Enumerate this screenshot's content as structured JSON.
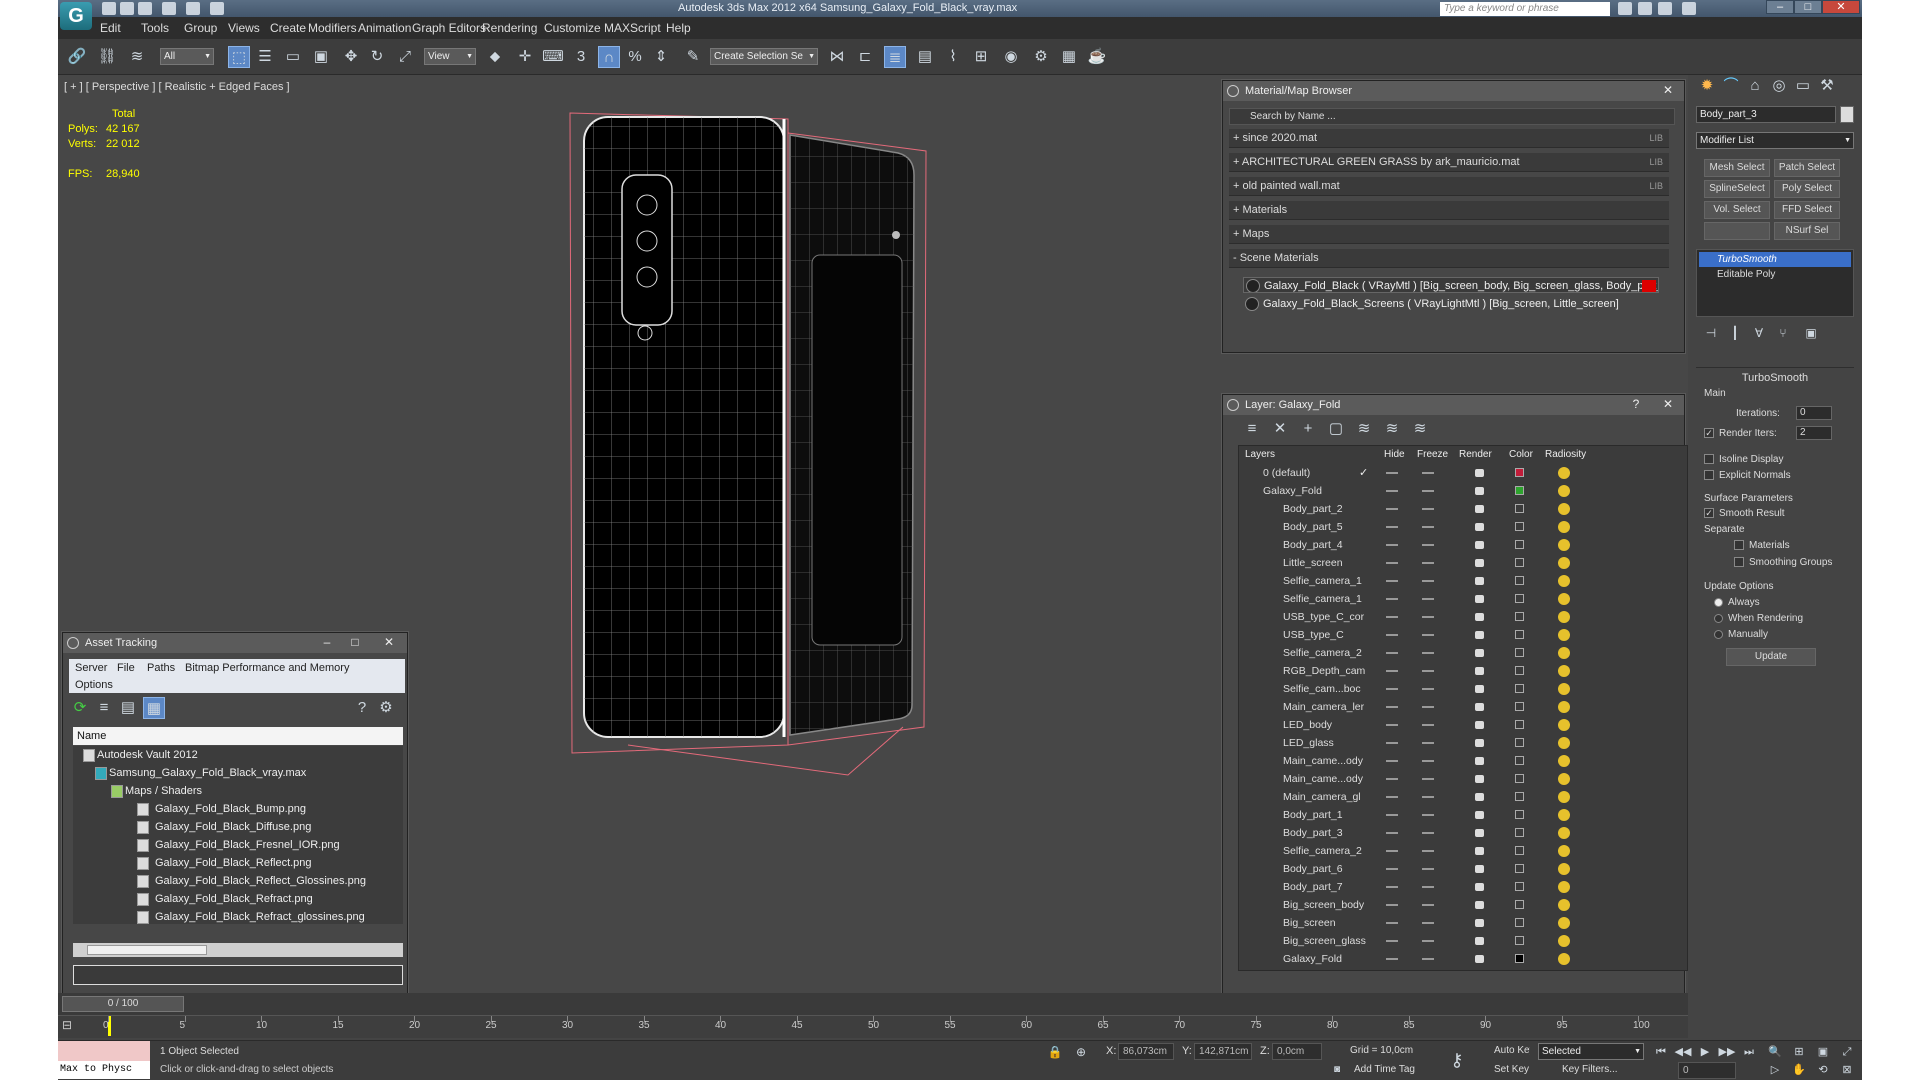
{
  "window": {
    "title": "Autodesk 3ds Max  2012 x64      Samsung_Galaxy_Fold_Black_vray.max",
    "search_placeholder": "Type a keyword or phrase",
    "app_icon": "3ds-max-logo"
  },
  "menu": [
    "Edit",
    "Tools",
    "Group",
    "Views",
    "Create",
    "Modifiers",
    "Animation",
    "Graph Editors",
    "Rendering",
    "Customize",
    "MAXScript",
    "Help"
  ],
  "toolbar": {
    "filter": "All",
    "ref_coord": "View",
    "selection_set": "Create Selection Se"
  },
  "viewport": {
    "label": "[ + ] [ Perspective ] [ Realistic + Edged Faces ]",
    "stats": {
      "total": "Total",
      "polys_label": "Polys:",
      "polys": "42 167",
      "verts_label": "Verts:",
      "verts": "22 012",
      "fps_label": "FPS:",
      "fps": "28,940"
    }
  },
  "material_browser": {
    "title": "Material/Map Browser",
    "search": "Search by Name ...",
    "groups": [
      {
        "label": "+ since 2020.mat",
        "tag": "LIB"
      },
      {
        "label": "+ ARCHITECTURAL GREEN GRASS by ark_mauricio.mat",
        "tag": "LIB"
      },
      {
        "label": "+ old painted wall.mat",
        "tag": "LIB"
      },
      {
        "label": "+ Materials",
        "tag": ""
      },
      {
        "label": "+ Maps",
        "tag": ""
      },
      {
        "label": "- Scene Materials",
        "tag": ""
      }
    ],
    "scene_materials": [
      "Galaxy_Fold_Black ( VRayMtl ) [Big_screen_body, Big_screen_glass, Body_part_",
      "Galaxy_Fold_Black_Screens ( VRayLightMtl ) [Big_screen, Little_screen]"
    ]
  },
  "layer_manager": {
    "title": "Layer: Galaxy_Fold",
    "columns": [
      "Layers",
      "Hide",
      "Freeze",
      "Render",
      "Color",
      "Radiosity"
    ],
    "layers": [
      "0 (default)",
      "Galaxy_Fold"
    ],
    "objects": [
      "Body_part_2",
      "Body_part_5",
      "Body_part_4",
      "Little_screen",
      "Selfie_camera_1",
      "Selfie_camera_1",
      "USB_type_C_cor",
      "USB_type_C",
      "Selfie_camera_2",
      "RGB_Depth_cam",
      "Selfie_cam...boc",
      "Main_camera_ler",
      "LED_body",
      "LED_glass",
      "Main_came...ody",
      "Main_came...ody",
      "Main_camera_gl",
      "Body_part_1",
      "Body_part_3",
      "Selfie_camera_2",
      "Body_part_6",
      "Body_part_7",
      "Big_screen_body",
      "Big_screen",
      "Big_screen_glass",
      "Galaxy_Fold"
    ]
  },
  "asset_tracking": {
    "title": "Asset Tracking",
    "menu": [
      "Server",
      "File",
      "Paths",
      "Bitmap Performance and Memory",
      "Options"
    ],
    "column": "Name",
    "tree": [
      "Autodesk Vault 2012",
      "Samsung_Galaxy_Fold_Black_vray.max",
      "Maps / Shaders"
    ],
    "files": [
      "Galaxy_Fold_Black_Bump.png",
      "Galaxy_Fold_Black_Diffuse.png",
      "Galaxy_Fold_Black_Fresnel_IOR.png",
      "Galaxy_Fold_Black_Reflect.png",
      "Galaxy_Fold_Black_Reflect_Glossines.png",
      "Galaxy_Fold_Black_Refract.png",
      "Galaxy_Fold_Black_Refract_glossines.png"
    ]
  },
  "command_panel": {
    "object_name": "Body_part_3",
    "modifier_list": "Modifier List",
    "buttons": [
      "Mesh Select",
      "Patch Select",
      "SplineSelect",
      "Poly Select",
      "Vol. Select",
      "FFD Select",
      "",
      "NSurf Sel"
    ],
    "stack": [
      "TurboSmooth",
      "Editable Poly"
    ],
    "turbosmooth": {
      "title": "TurboSmooth",
      "main": "Main",
      "iterations_label": "Iterations:",
      "iterations": "0",
      "render_iters_label": "Render Iters:",
      "render_iters": "2",
      "isoline": "Isoline Display",
      "explicit": "Explicit Normals",
      "surface": "Surface Parameters",
      "smooth_result": "Smooth Result",
      "separate": "Separate",
      "materials": "Materials",
      "smoothing_groups": "Smoothing Groups",
      "update_options": "Update Options",
      "always": "Always",
      "when_rendering": "When Rendering",
      "manually": "Manually",
      "update": "Update"
    }
  },
  "timeline": {
    "frame": "0 / 100",
    "ticks": [
      "0",
      "5",
      "10",
      "15",
      "20",
      "25",
      "30",
      "35",
      "40",
      "45",
      "50",
      "55",
      "60",
      "65",
      "70",
      "75",
      "80",
      "85",
      "90",
      "95",
      "100"
    ]
  },
  "status": {
    "maxscript": "Max to Physc",
    "selected": "1 Object Selected",
    "prompt": "Click or click-and-drag to select objects",
    "x_label": "X:",
    "x": "86,073cm",
    "y_label": "Y:",
    "y": "142,871cm",
    "z_label": "Z:",
    "z": "0,0cm",
    "grid": "Grid = 10,0cm",
    "add_time_tag": "Add Time Tag",
    "auto_key": "Auto Key",
    "set_key": "Set Key",
    "key_mode": "Selected",
    "key_filters": "Key Filters...",
    "current_frame": "0"
  }
}
